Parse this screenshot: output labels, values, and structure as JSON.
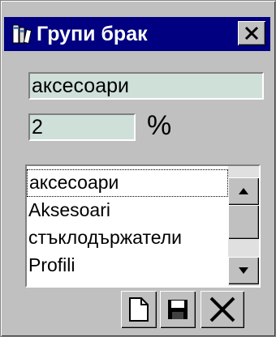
{
  "window": {
    "title": "Групи брак",
    "title_icon": "books-icon",
    "close_icon": "close-icon",
    "colors": {
      "titlebar": "#000080",
      "field_bg": "#cfe0d9",
      "face": "#c0c0c0"
    }
  },
  "form": {
    "name_value": "аксесоари",
    "percent_value": "2",
    "percent_label": "%"
  },
  "list": {
    "items": [
      {
        "label": "аксесоари"
      },
      {
        "label": "Aksesoari"
      },
      {
        "label": "стъклодържатели"
      },
      {
        "label": "Profili"
      }
    ],
    "selected_index": 0
  },
  "toolbar": {
    "new_icon": "new-document-icon",
    "save_icon": "save-disk-icon",
    "delete_icon": "delete-x-icon"
  }
}
